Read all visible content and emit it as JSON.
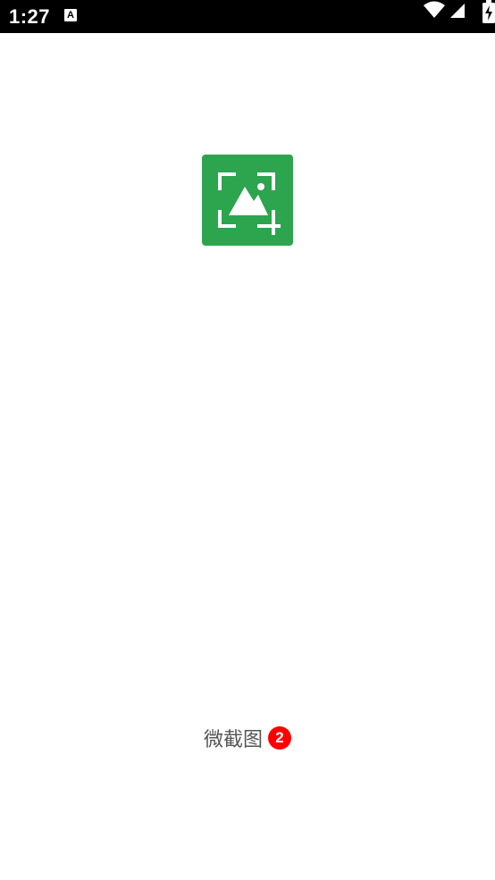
{
  "status_bar": {
    "time": "1:27",
    "notification_icon": "a-icon",
    "notification_letter": "A",
    "wifi_icon": "wifi-icon",
    "signal_icon": "signal-icon",
    "battery_icon": "battery-charging-icon"
  },
  "splash": {
    "logo_icon": "image-crop-icon",
    "logo_color": "#2da44e",
    "app_name": "微截图",
    "badge": "2",
    "badge_color": "#ff0000"
  }
}
